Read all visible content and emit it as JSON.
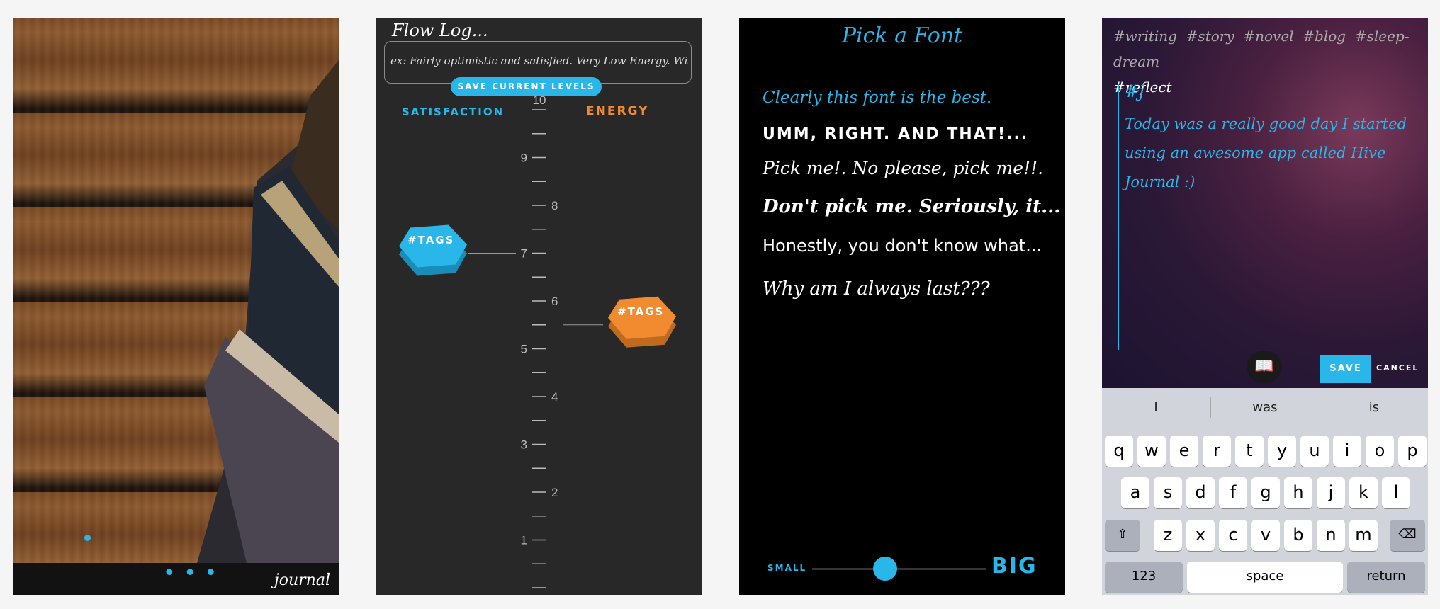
{
  "panel1": {
    "journal_label": "journal",
    "menu_dots": "• • •"
  },
  "panel2": {
    "title": "Flow Log...",
    "input_placeholder": "ex: Fairly optimistic and satisfied. Very Low Energy. Wishing y...",
    "save_button": "SAVE CURRENT LEVELS",
    "satisfaction_label": "SATISFACTION",
    "energy_label": "ENERGY",
    "scale_labels": [
      "10",
      "9",
      "8",
      "7",
      "6",
      "5",
      "4",
      "3",
      "2",
      "1"
    ],
    "satisfaction_tag": "#TAGS",
    "energy_tag": "#TAGS",
    "satisfaction_value": 7,
    "energy_value": 5.5,
    "colors": {
      "satisfaction": "#29b6e8",
      "energy": "#f28a30"
    }
  },
  "panel3": {
    "title": "Pick a Font",
    "options": [
      "Clearly this font is the best.",
      "UMM, RIGHT. AND THAT!...",
      "Pick me!. No please, pick me!!.",
      "Don't pick me. Seriously, it...",
      "Honestly, you don't know what...",
      "Why am I always last???"
    ],
    "size_small": "SMALL",
    "size_big": "BIG",
    "size_value": 0.42
  },
  "panel4": {
    "tags": [
      "#writing",
      "#story",
      "#novel",
      "#blog",
      "#sleep-dream",
      "#reflect"
    ],
    "hash_input": "#j",
    "entry_text": "Today was a really good day I started using an awesome app called Hive Journal :)",
    "save_button": "SAVE",
    "cancel_button": "CANCEL",
    "suggestions": [
      "I",
      "was",
      "is"
    ],
    "row1": [
      "q",
      "w",
      "e",
      "r",
      "t",
      "y",
      "u",
      "i",
      "o",
      "p"
    ],
    "row2": [
      "a",
      "s",
      "d",
      "f",
      "g",
      "h",
      "j",
      "k",
      "l"
    ],
    "row3": [
      "z",
      "x",
      "c",
      "v",
      "b",
      "n",
      "m"
    ],
    "key_123": "123",
    "key_space": "space",
    "key_return": "return",
    "shift_icon": "⇧",
    "delete_icon": "⌫"
  }
}
